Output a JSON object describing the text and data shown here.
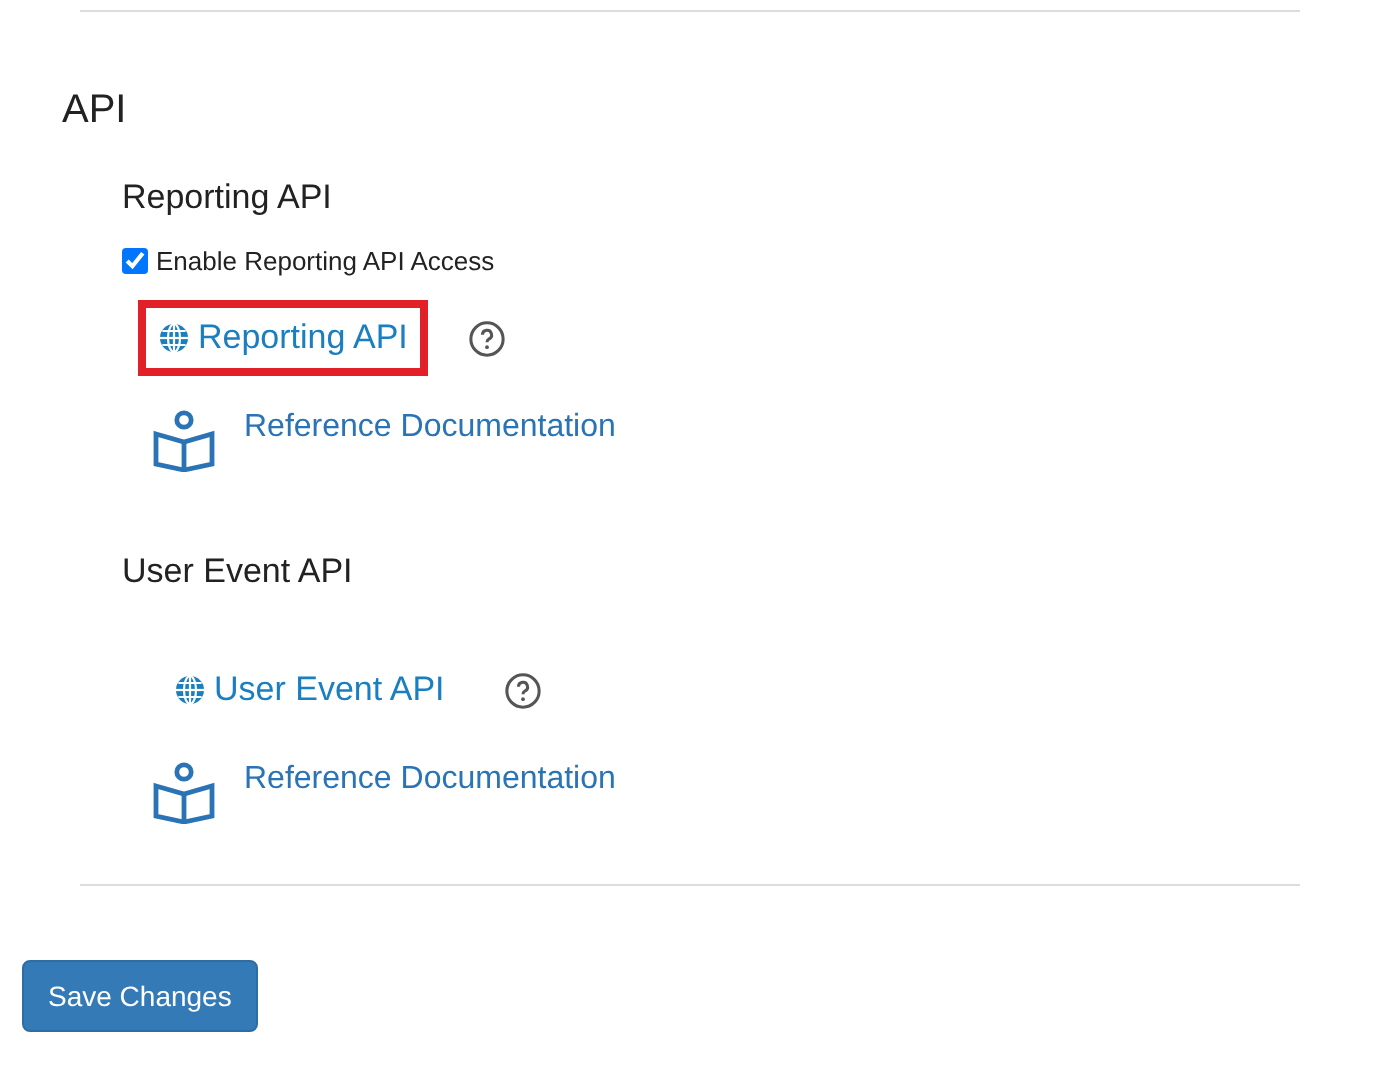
{
  "section_title": "API",
  "groups": [
    {
      "title": "Reporting API",
      "checkbox": {
        "label": "Enable Reporting API Access",
        "checked": true
      },
      "api_link": {
        "label": "Reporting API",
        "highlighted": true
      },
      "docs_link": {
        "label": "Reference Documentation"
      }
    },
    {
      "title": "User Event API",
      "api_link": {
        "label": "User Event API",
        "highlighted": false
      },
      "docs_link": {
        "label": "Reference Documentation"
      }
    }
  ],
  "save_button": "Save Changes"
}
